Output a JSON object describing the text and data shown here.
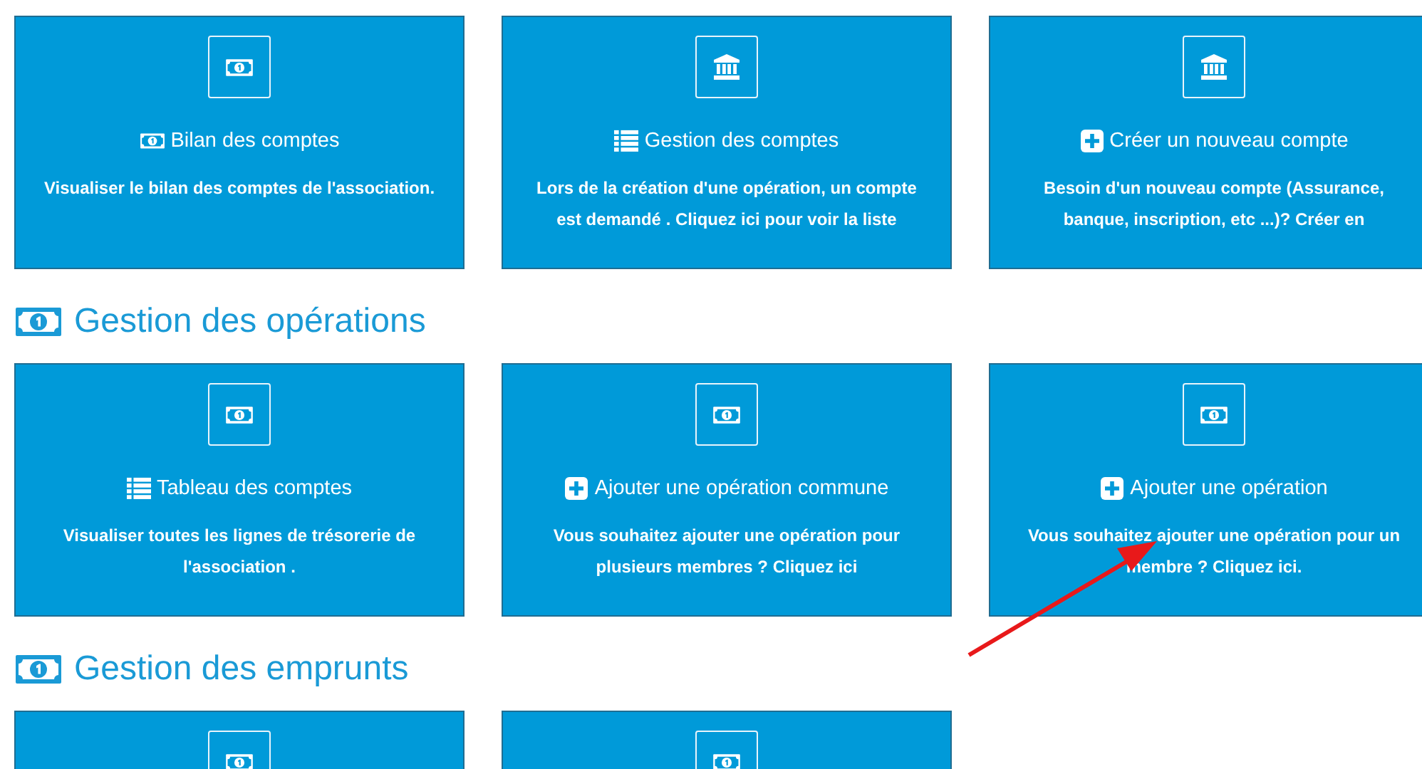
{
  "sections": [
    {
      "cards": [
        {
          "kind": "summary",
          "title": "Bilan des comptes",
          "description": "Visualiser le bilan des comptes de l'association."
        },
        {
          "kind": "accounts",
          "title": "Gestion des comptes",
          "description": "Lors de la création d'une opération, un compte est demandé . Cliquez ici pour voir la liste"
        },
        {
          "kind": "newaccount",
          "title": "Créer un nouveau compte",
          "description": "Besoin d'un nouveau compte (Assurance, banque, inscription, etc ...)? Créer en"
        }
      ]
    },
    {
      "heading": "Gestion des opérations",
      "cards": [
        {
          "kind": "table",
          "title": "Tableau des comptes",
          "description": "Visualiser toutes les lignes de trésorerie de l'association ."
        },
        {
          "kind": "add",
          "title": "Ajouter une opération commune",
          "description": "Vous souhaitez ajouter une opération pour plusieurs membres ? Cliquez ici"
        },
        {
          "kind": "add",
          "title": "Ajouter une opération",
          "description": "Vous souhaitez ajouter une opération pour un membre ? Cliquez ici."
        }
      ]
    },
    {
      "heading": "Gestion des emprunts",
      "cards": [
        {
          "kind": "loan"
        },
        {
          "kind": "loan"
        }
      ]
    }
  ]
}
